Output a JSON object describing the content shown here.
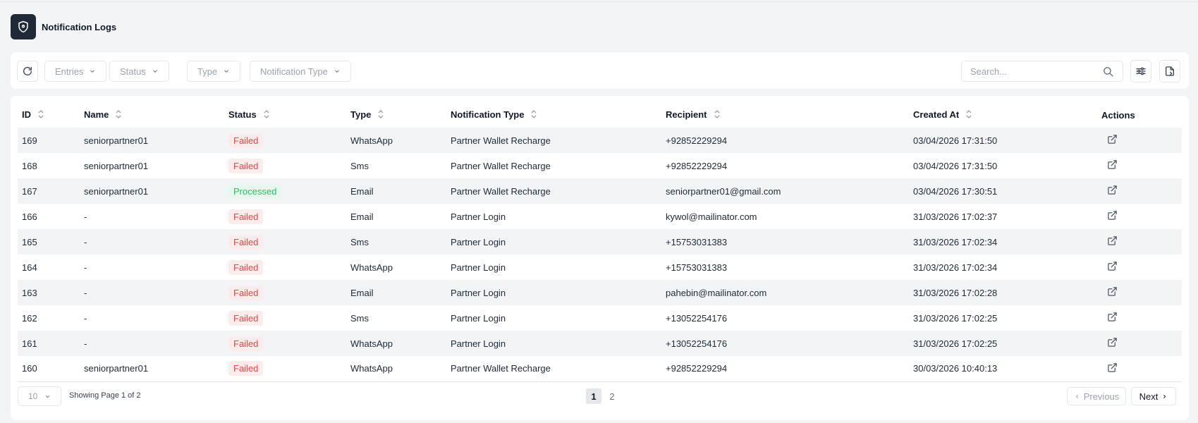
{
  "header": {
    "title": "Notification Logs",
    "logo_icon": "shield-icon"
  },
  "toolbar": {
    "refresh_icon": "refresh-icon",
    "filters": [
      {
        "label": "Entries"
      },
      {
        "label": "Status"
      },
      {
        "label": "Type"
      },
      {
        "label": "Notification Type"
      }
    ],
    "search": {
      "placeholder": "Search...",
      "value": ""
    },
    "settings_icon": "sliders-icon",
    "export_icon": "export-file-icon"
  },
  "table": {
    "columns": [
      "ID",
      "Name",
      "Status",
      "Type",
      "Notification Type",
      "Recipient",
      "Created At",
      "Actions"
    ],
    "rows": [
      {
        "id": "169",
        "name": "seniorpartner01",
        "status": "Failed",
        "type": "WhatsApp",
        "notification_type": "Partner Wallet Recharge",
        "recipient": "+92852229294",
        "created_at": "03/04/2026 17:31:50"
      },
      {
        "id": "168",
        "name": "seniorpartner01",
        "status": "Failed",
        "type": "Sms",
        "notification_type": "Partner Wallet Recharge",
        "recipient": "+92852229294",
        "created_at": "03/04/2026 17:31:50"
      },
      {
        "id": "167",
        "name": "seniorpartner01",
        "status": "Processed",
        "type": "Email",
        "notification_type": "Partner Wallet Recharge",
        "recipient": "seniorpartner01@gmail.com",
        "created_at": "03/04/2026 17:30:51"
      },
      {
        "id": "166",
        "name": "-",
        "status": "Failed",
        "type": "Email",
        "notification_type": "Partner Login",
        "recipient": "kywol@mailinator.com",
        "created_at": "31/03/2026 17:02:37"
      },
      {
        "id": "165",
        "name": "-",
        "status": "Failed",
        "type": "Sms",
        "notification_type": "Partner Login",
        "recipient": "+15753031383",
        "created_at": "31/03/2026 17:02:34"
      },
      {
        "id": "164",
        "name": "-",
        "status": "Failed",
        "type": "WhatsApp",
        "notification_type": "Partner Login",
        "recipient": "+15753031383",
        "created_at": "31/03/2026 17:02:34"
      },
      {
        "id": "163",
        "name": "-",
        "status": "Failed",
        "type": "Email",
        "notification_type": "Partner Login",
        "recipient": "pahebin@mailinator.com",
        "created_at": "31/03/2026 17:02:28"
      },
      {
        "id": "162",
        "name": "-",
        "status": "Failed",
        "type": "Sms",
        "notification_type": "Partner Login",
        "recipient": "+13052254176",
        "created_at": "31/03/2026 17:02:25"
      },
      {
        "id": "161",
        "name": "-",
        "status": "Failed",
        "type": "WhatsApp",
        "notification_type": "Partner Login",
        "recipient": "+13052254176",
        "created_at": "31/03/2026 17:02:25"
      },
      {
        "id": "160",
        "name": "seniorpartner01",
        "status": "Failed",
        "type": "WhatsApp",
        "notification_type": "Partner Wallet Recharge",
        "recipient": "+92852229294",
        "created_at": "30/03/2026 10:40:13"
      }
    ]
  },
  "footer": {
    "per_page": "10",
    "showing": "Showing Page 1 of 2",
    "pages": [
      "1",
      "2"
    ],
    "active_page": "1",
    "prev_label": "Previous",
    "next_label": "Next"
  },
  "colors": {
    "failed_text": "#ef4444",
    "failed_bg": "#fdecec",
    "processed_text": "#22c55e",
    "processed_bg": "#e8f7ef",
    "logo_bg": "#1f2937"
  }
}
